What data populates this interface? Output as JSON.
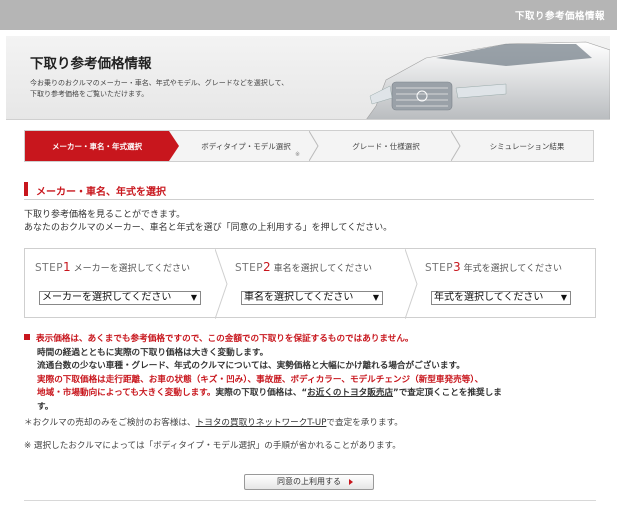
{
  "header": {
    "top_title": "下取り参考価格情報"
  },
  "hero": {
    "title": "下取り参考価格情報",
    "desc_line1": "今お乗りのおクルマのメーカー・車名、年式やモデル、グレードなどを選択して、",
    "desc_line2": "下取り参考価格をご覧いただけます。"
  },
  "tabs": [
    {
      "label": "メーカー・車名・年式選択"
    },
    {
      "label": "ボディタイプ・モデル選択",
      "note": "※"
    },
    {
      "label": "グレード・仕様選択"
    },
    {
      "label": "シミュレーション結果"
    }
  ],
  "section": {
    "title": "メーカー・車名、年式を選択",
    "intro1": "下取り参考価格を見ることができます。",
    "intro2": "あなたのおクルマのメーカー、車名と年式を選び「同意の上利用する」を押してください。"
  },
  "steps": [
    {
      "word": "STEP",
      "num": "1",
      "text": "メーカーを選択してください",
      "select": "メーカーを選択してください"
    },
    {
      "word": "STEP",
      "num": "2",
      "text": "車名を選択してください",
      "select": "車名を選択してください"
    },
    {
      "word": "STEP",
      "num": "3",
      "text": "年式を選択してください",
      "select": "年式を選択してください"
    }
  ],
  "notes": {
    "n1": "表示価格は、あくまでも参考価格ですので、この金額での下取りを保証するものではありません。",
    "n2": "時間の経過とともに実際の下取り価格は大きく変動します。",
    "n3": "流通台数の少ない車種・グレード、年式のクルマについては、実勢価格と大幅にかけ離れる場合がございます。",
    "n4": "実際の下取価格は走行距離、お車の状態（キズ・凹み）、事故歴、ボディカラー、モデルチェンジ（新型車発売等）、",
    "n5a": "地域・市場動向によっても大きく変動します。",
    "n5b": "実際の下取り価格は、“",
    "n5link": "お近くのトヨタ販売店",
    "n5c": "”で査定頂くことを推奨しま",
    "n6": "す。",
    "n7a": "＊おクルマの売却のみをご検討のお客様は、",
    "n7link": "トヨタの買取りネットワークT-UP",
    "n7b": "で査定を承ります。",
    "n8": "※ 選択したおクルマによっては「ボディタイプ・モデル選択」の手順が省かれることがあります。"
  },
  "agree_button": "同意の上利用する",
  "colors": {
    "accent": "#c8161d",
    "header_gray": "#b5b5b5"
  }
}
